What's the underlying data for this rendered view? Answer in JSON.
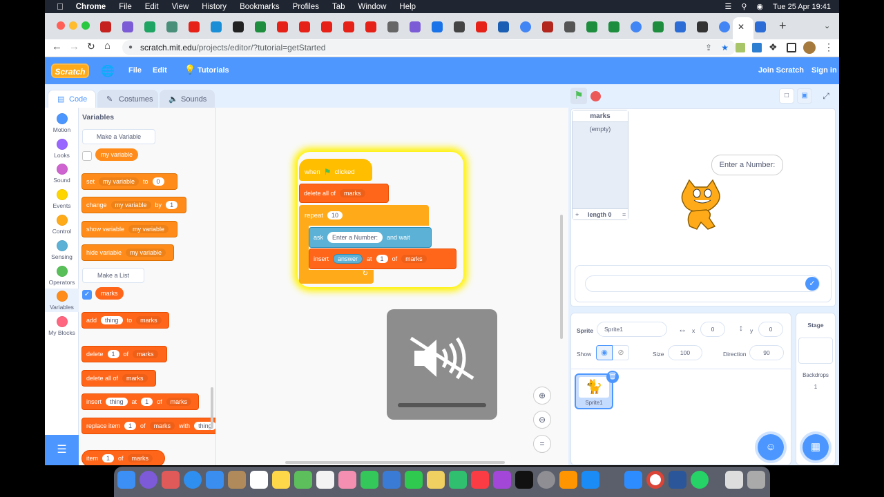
{
  "menubar": {
    "app": "Chrome",
    "items": [
      "File",
      "Edit",
      "View",
      "History",
      "Bookmarks",
      "Profiles",
      "Tab",
      "Window",
      "Help"
    ],
    "clock": "Tue 25 Apr  19:41"
  },
  "browser": {
    "url_host": "scratch.mit.edu",
    "url_path": "/projects/editor/?tutorial=getStarted"
  },
  "header": {
    "logo": "Scratch",
    "file": "File",
    "edit": "Edit",
    "tutorials": "Tutorials",
    "join": "Join Scratch",
    "signin": "Sign in"
  },
  "tabs": {
    "code": "Code",
    "costumes": "Costumes",
    "sounds": "Sounds"
  },
  "categories": [
    {
      "label": "Motion",
      "color": "#4c97ff"
    },
    {
      "label": "Looks",
      "color": "#9966ff"
    },
    {
      "label": "Sound",
      "color": "#cf63cf"
    },
    {
      "label": "Events",
      "color": "#ffd500"
    },
    {
      "label": "Control",
      "color": "#ffab19"
    },
    {
      "label": "Sensing",
      "color": "#5cb1d6"
    },
    {
      "label": "Operators",
      "color": "#59c059"
    },
    {
      "label": "Variables",
      "color": "#ff8c1a"
    },
    {
      "label": "My Blocks",
      "color": "#ff6680"
    }
  ],
  "palette": {
    "heading": "Variables",
    "make_variable": "Make a Variable",
    "my_variable": "my variable",
    "set": "set",
    "to": "to",
    "zero": "0",
    "change": "change",
    "by": "by",
    "one": "1",
    "show_variable": "show variable",
    "hide_variable": "hide variable",
    "make_list": "Make a List",
    "marks": "marks",
    "add": "add",
    "thing": "thing",
    "delete": "delete",
    "of": "of",
    "delete_all_of": "delete all of",
    "insert": "insert",
    "at": "at",
    "replace_item": "replace item",
    "with": "with",
    "item": "item"
  },
  "script": {
    "when": "when",
    "clicked": "clicked",
    "delete_all_of": "delete all of",
    "marks": "marks",
    "repeat": "repeat",
    "ten": "10",
    "ask": "ask",
    "prompt": "Enter a Number:",
    "and_wait": "and wait",
    "insert": "insert",
    "answer": "answer",
    "at": "at",
    "one": "1",
    "of": "of"
  },
  "stage": {
    "list_title": "marks",
    "list_empty": "(empty)",
    "list_plus": "+",
    "list_length": "length 0",
    "list_eq": "=",
    "bubble": "Enter a Number:"
  },
  "sprite_info": {
    "sprite_label": "Sprite",
    "sprite_name": "Sprite1",
    "x_label": "x",
    "x": "0",
    "y_label": "y",
    "y": "0",
    "show_label": "Show",
    "size_label": "Size",
    "size": "100",
    "direction_label": "Direction",
    "direction": "90",
    "thumb_name": "Sprite1"
  },
  "stage_pane": {
    "title": "Stage",
    "backdrops_label": "Backdrops",
    "backdrops_count": "1"
  }
}
